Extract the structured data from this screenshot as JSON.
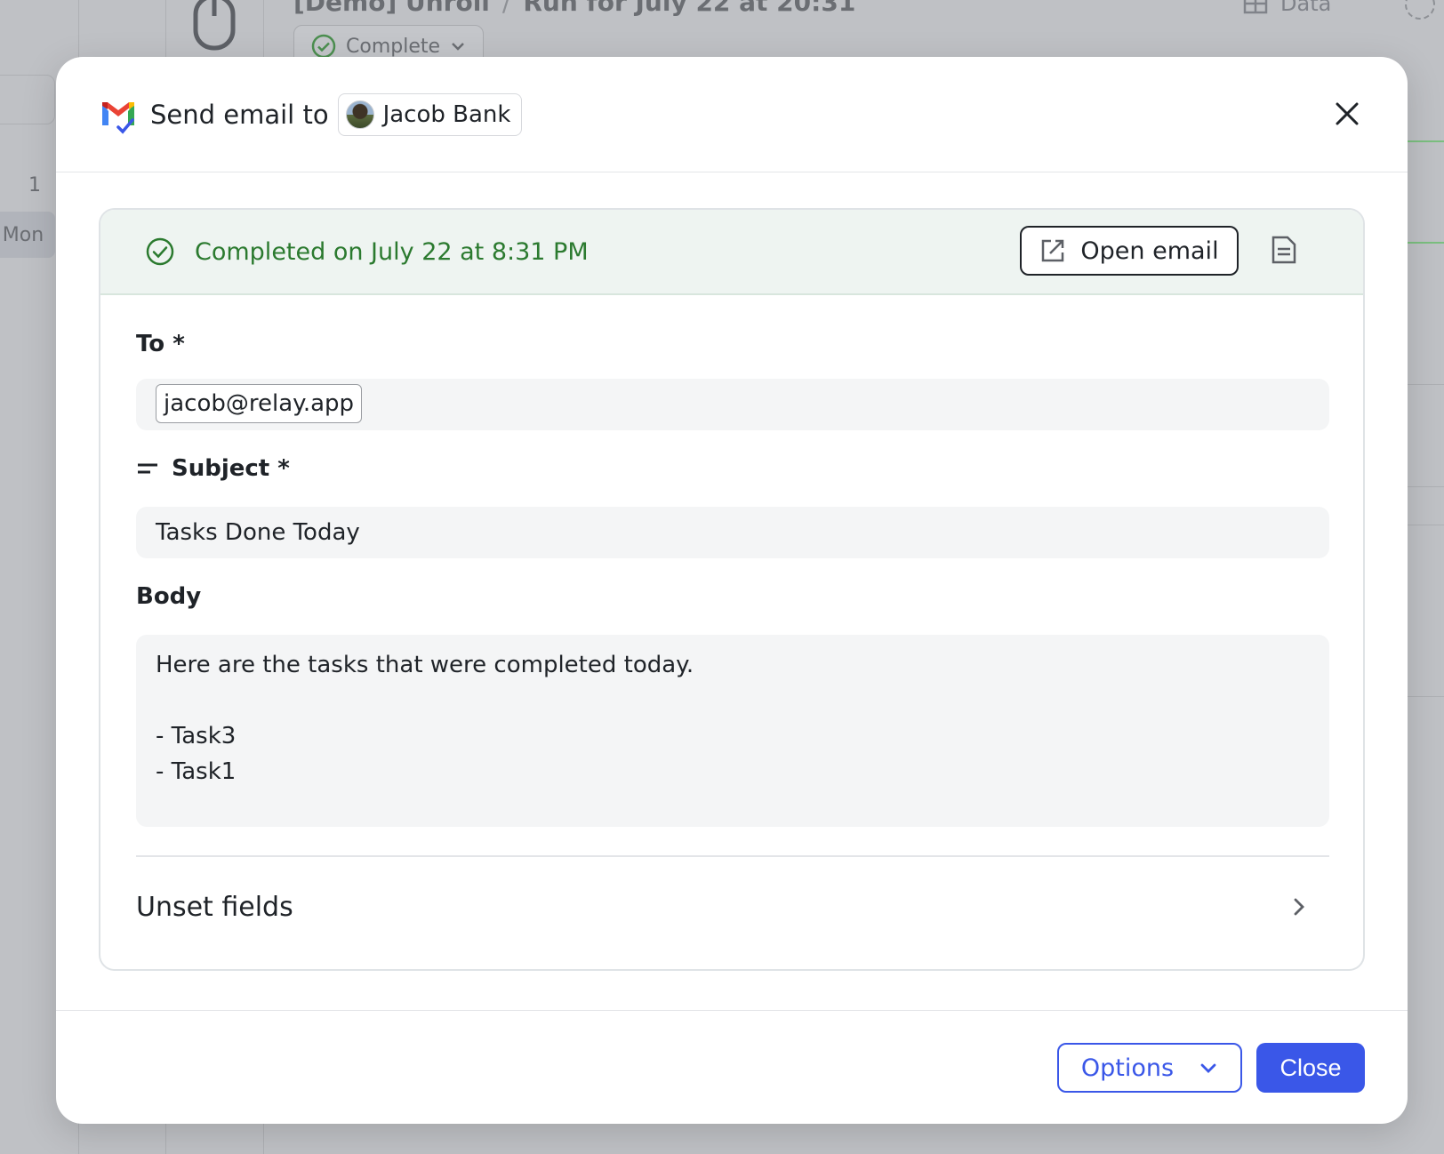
{
  "background": {
    "run_title_left": "[Demo] Unroll",
    "run_title_sep": "/",
    "run_title_right": "Run for July 22 at 20:31",
    "status_pill": "Complete",
    "data_tab": "Data",
    "day_number": "1",
    "day_name": "Mon"
  },
  "modal": {
    "header_prefix": "Send email to",
    "recipient_name": "Jacob Bank",
    "status_text": "Completed on July 22 at 8:31 PM",
    "open_email_label": "Open email",
    "to_label": "To *",
    "to_value": "jacob@relay.app",
    "subject_label": "Subject *",
    "subject_value": "Tasks Done Today",
    "body_label": "Body",
    "body_value": "Here are the tasks that were completed today.\n\n-  Task3\n-  Task1",
    "unset_fields_label": "Unset fields",
    "options_label": "Options",
    "close_label": "Close"
  },
  "colors": {
    "accent": "#3a57e8",
    "success": "#2b7a2f",
    "overlay": "#bfc1c5"
  },
  "icons": [
    "gmail-icon",
    "close-icon",
    "check-circle-icon",
    "external-link-icon",
    "document-icon",
    "text-lines-icon",
    "chevron-right-icon",
    "chevron-down-icon",
    "mouse-icon",
    "table-icon"
  ]
}
